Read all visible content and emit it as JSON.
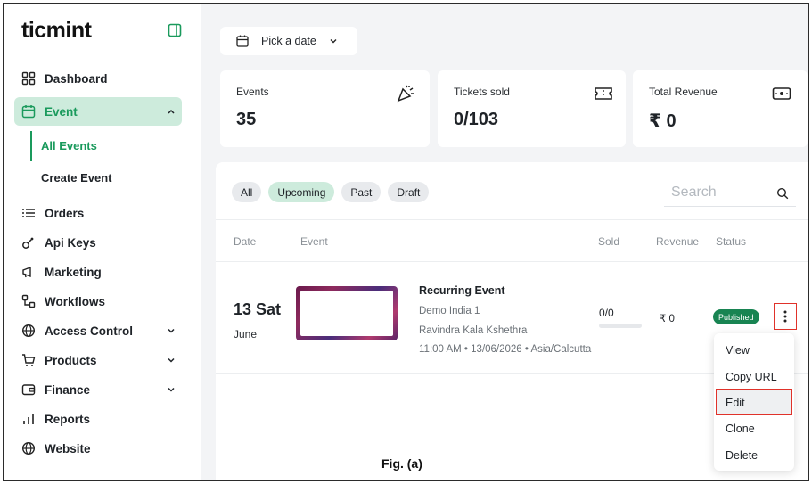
{
  "app": {
    "logo": "ticmint"
  },
  "sidebar": {
    "items": [
      {
        "label": "Dashboard",
        "icon": "grid-icon"
      },
      {
        "label": "Event",
        "icon": "calendar-icon",
        "active": true
      },
      {
        "label": "Orders",
        "icon": "list-icon"
      },
      {
        "label": "Api Keys",
        "icon": "key-icon"
      },
      {
        "label": "Marketing",
        "icon": "megaphone-icon"
      },
      {
        "label": "Workflows",
        "icon": "workflow-icon"
      },
      {
        "label": "Access Control",
        "icon": "globe-lock-icon"
      },
      {
        "label": "Products",
        "icon": "cart-icon"
      },
      {
        "label": "Finance",
        "icon": "wallet-icon"
      },
      {
        "label": "Reports",
        "icon": "bar-chart-icon"
      },
      {
        "label": "Website",
        "icon": "globe-icon"
      }
    ],
    "event_sub": {
      "all_events": "All Events",
      "create_event": "Create Event"
    }
  },
  "toolbar": {
    "date_label": "Pick a date"
  },
  "stats": {
    "events": {
      "label": "Events",
      "value": "35"
    },
    "tickets": {
      "label": "Tickets sold",
      "value": "0/103"
    },
    "revenue": {
      "label": "Total Revenue",
      "value": "₹ 0"
    }
  },
  "filters": [
    "All",
    "Upcoming",
    "Past",
    "Draft"
  ],
  "active_filter": "Upcoming",
  "search": {
    "placeholder": "Search"
  },
  "table": {
    "headers": {
      "date": "Date",
      "event": "Event",
      "sold": "Sold",
      "revenue": "Revenue",
      "status": "Status"
    },
    "rows": [
      {
        "day": "13 Sat",
        "month": "June",
        "title": "Recurring Event",
        "org": "Demo India 1",
        "venue": "Ravindra Kala Kshethra",
        "time": "11:00 AM • 13/06/2026 • Asia/Calcutta",
        "sold": "0/0",
        "sold_fraction": 0,
        "revenue": "₹ 0",
        "status": "Published"
      }
    ]
  },
  "row_menu": [
    "View",
    "Copy URL",
    "Edit",
    "Clone",
    "Delete"
  ],
  "caption": "Fig. (a)",
  "colors": {
    "accent": "#1a9a5c",
    "active_bg": "#cdebdc",
    "highlight": "#e0322a",
    "badge": "#188452"
  }
}
